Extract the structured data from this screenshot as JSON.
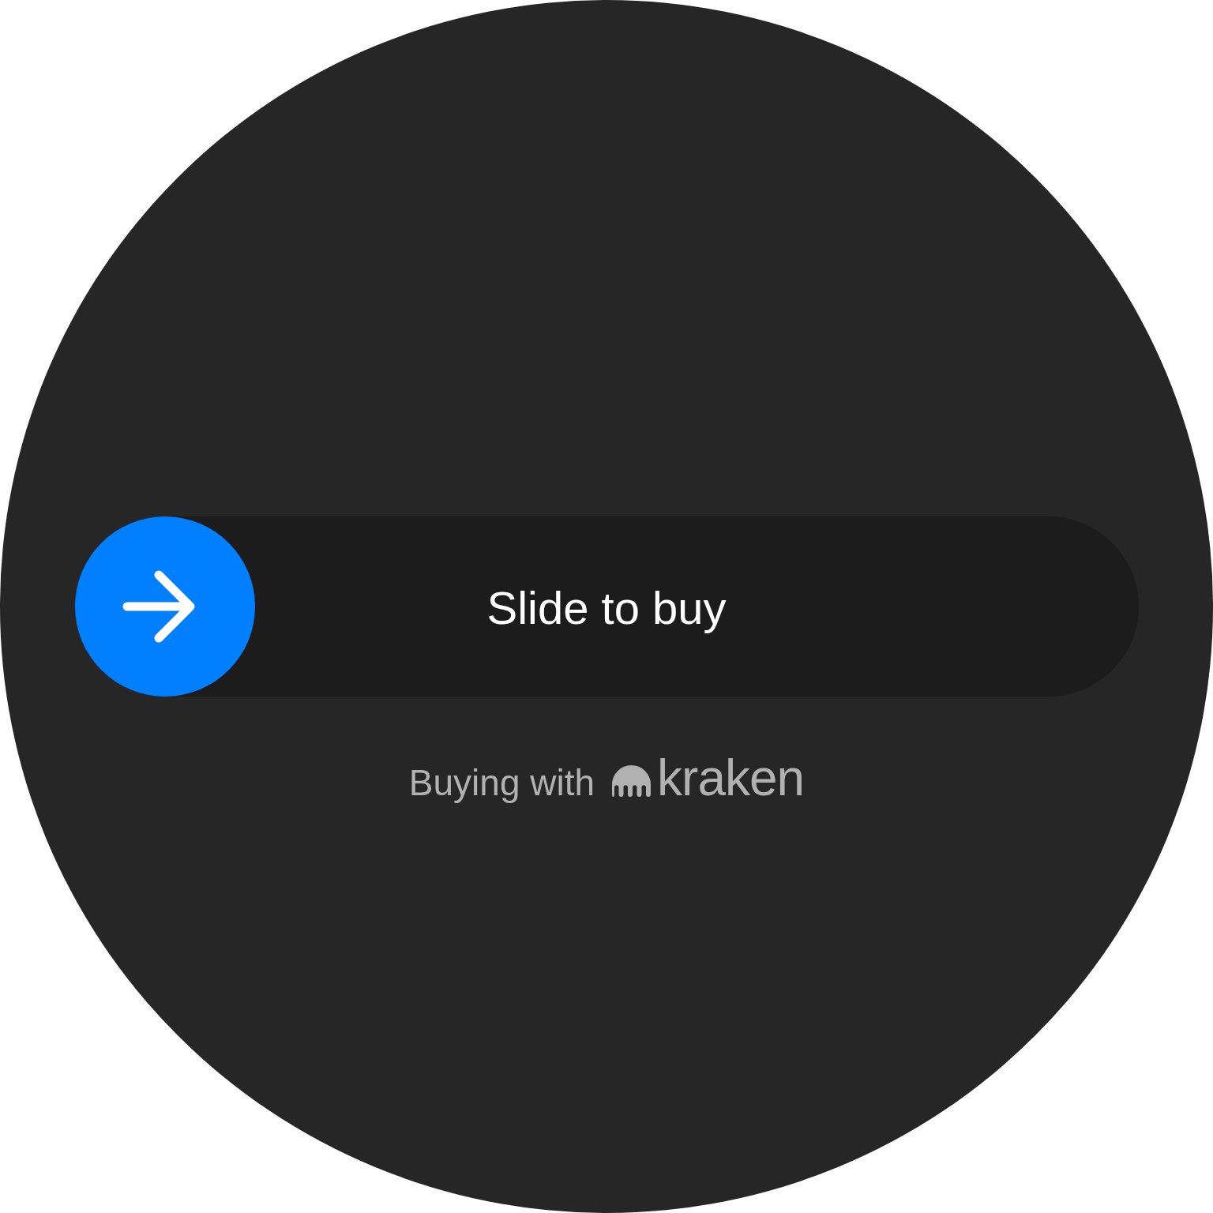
{
  "slider": {
    "label": "Slide to buy",
    "level": 0
  },
  "footer": {
    "text": "Buying with",
    "brand": "kraken"
  }
}
